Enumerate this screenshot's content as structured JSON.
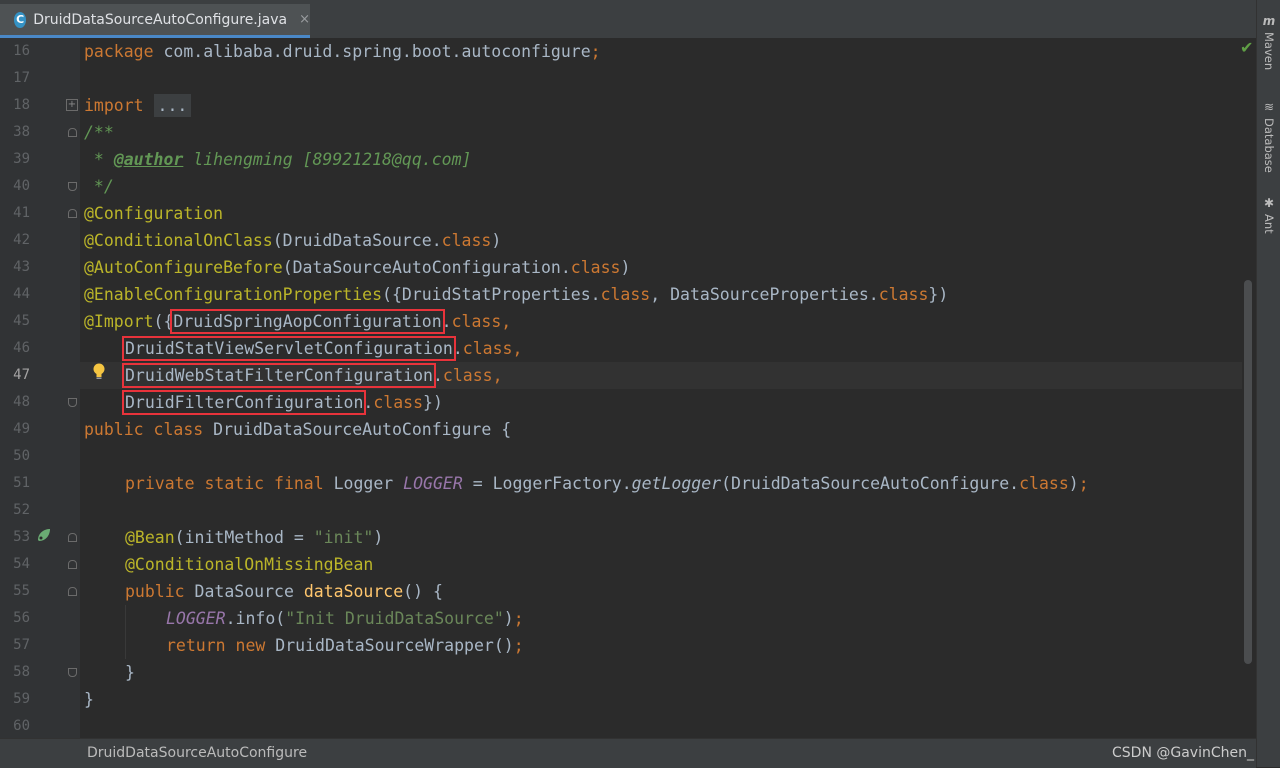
{
  "tab": {
    "filename": "DruidDataSourceAutoConfigure.java",
    "close": "×",
    "icon_letter": "C"
  },
  "right_panels": [
    {
      "icon": "m",
      "label": "Maven"
    },
    {
      "icon": "≋",
      "label": "Database"
    },
    {
      "icon": "✱",
      "label": "Ant"
    }
  ],
  "line_numbers": [
    "16",
    "17",
    "18",
    "38",
    "39",
    "40",
    "41",
    "42",
    "43",
    "44",
    "45",
    "46",
    "47",
    "48",
    "49",
    "50",
    "51",
    "52",
    "53",
    "54",
    "55",
    "56",
    "57",
    "58",
    "59",
    "60"
  ],
  "current_line": "47",
  "code": {
    "l16": {
      "kw": "package",
      "rest": " com.alibaba.druid.spring.boot.autoconfigure",
      "semi": ";"
    },
    "l18": {
      "kw": "import",
      "folded": "..."
    },
    "l38": "/**",
    "l39": {
      "star": " * ",
      "tag": "@author",
      "rest": " lihengming [89921218@qq.com]"
    },
    "l40": " */",
    "l41": "@Configuration",
    "l42": {
      "ann": "@ConditionalOnClass",
      "open": "(DruidDataSource.",
      "cls": "class",
      "close": ")"
    },
    "l43": {
      "ann": "@AutoConfigureBefore",
      "open": "(DataSourceAutoConfiguration.",
      "cls": "class",
      "close": ")"
    },
    "l44": {
      "ann": "@EnableConfigurationProperties",
      "a": "({DruidStatProperties.",
      "cls1": "class",
      "b": ", DataSourceProperties.",
      "cls2": "class",
      "close": "})"
    },
    "l45": {
      "ann": "@Import",
      "open": "({",
      "name": "DruidSpringAopConfiguration",
      "dot": ".",
      "cls": "class",
      "comma": ","
    },
    "l46": {
      "name": "DruidStatViewServletConfiguration",
      "dot": ".",
      "cls": "class",
      "comma": ","
    },
    "l47": {
      "name": "DruidWebStatFilterConfiguration",
      "dot": ".",
      "cls": "class",
      "comma": ","
    },
    "l48": {
      "name": "DruidFilterConfiguration",
      "dot": ".",
      "cls": "class",
      "close": "})"
    },
    "l49": {
      "kw": "public class",
      "rest": " DruidDataSourceAutoConfigure {"
    },
    "l51": {
      "kw": "private static final",
      "type": " Logger ",
      "field": "LOGGER",
      "eq": " = LoggerFactory.",
      "method": "getLogger",
      "arg": "(DruidDataSourceAutoConfigure.",
      "cls": "class",
      "close": ")",
      "semi": ";"
    },
    "l53": {
      "ann": "@Bean",
      "open": "(initMethod = ",
      "str": "\"init\"",
      "close": ")"
    },
    "l54": "@ConditionalOnMissingBean",
    "l55": {
      "kw": "public",
      "type": " DataSource ",
      "fn": "dataSource",
      "rest": "() {"
    },
    "l56": {
      "field": "LOGGER",
      "call": ".info(",
      "str": "\"Init DruidDataSource\"",
      "close": ")",
      "semi": ";"
    },
    "l57": {
      "kw": "return new",
      "rest": " DruidDataSourceWrapper()",
      "semi": ";"
    },
    "l58": "}",
    "l59": "}"
  },
  "status": {
    "breadcrumb": "DruidDataSourceAutoConfigure",
    "watermark": "CSDN @GavinChen_"
  },
  "colors": {
    "background": "#2b2b2b",
    "keyword": "#cc7832",
    "annotation": "#bbb529",
    "string": "#6a8759",
    "highlight_box": "#e8333b"
  }
}
